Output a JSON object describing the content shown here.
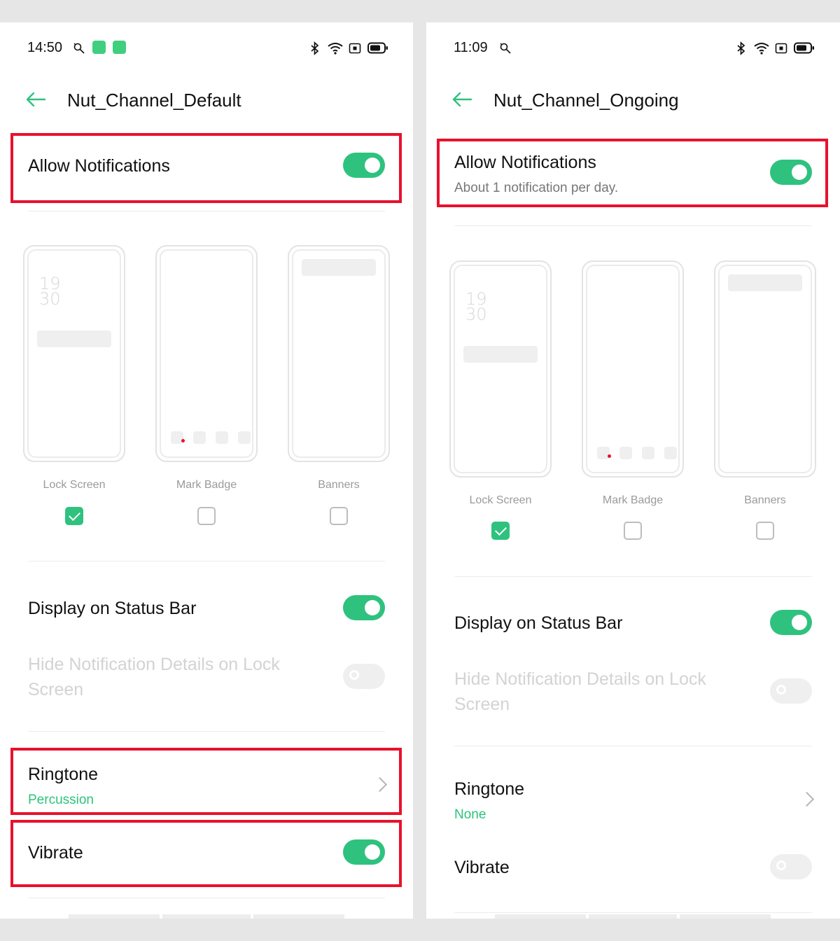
{
  "colors": {
    "accent": "#2ec27e",
    "highlight": "#e8112d",
    "disabled_text": "#d3d3d3"
  },
  "left": {
    "time": "14:50",
    "status_icons": [
      "bluetooth-icon",
      "wifi-icon",
      "nfc-icon",
      "battery-icon"
    ],
    "title": "Nut_Channel_Default",
    "allow_notifications": {
      "label": "Allow Notifications",
      "on": true
    },
    "options": [
      {
        "label": "Lock Screen",
        "checked": true
      },
      {
        "label": "Mark Badge",
        "checked": false
      },
      {
        "label": "Banners",
        "checked": false
      }
    ],
    "display_status_bar": {
      "label": "Display on Status Bar",
      "on": true
    },
    "hide_details": {
      "label": "Hide Notification Details on Lock Screen",
      "on": false,
      "enabled": false
    },
    "ringtone": {
      "label": "Ringtone",
      "value": "Percussion"
    },
    "vibrate": {
      "label": "Vibrate",
      "on": true
    }
  },
  "right": {
    "time": "11:09",
    "status_icons": [
      "bluetooth-icon",
      "wifi-icon",
      "nfc-icon",
      "battery-icon"
    ],
    "title": "Nut_Channel_Ongoing",
    "allow_notifications": {
      "label": "Allow Notifications",
      "subtitle": "About 1 notification per day.",
      "on": true
    },
    "options": [
      {
        "label": "Lock Screen",
        "checked": true
      },
      {
        "label": "Mark Badge",
        "checked": false
      },
      {
        "label": "Banners",
        "checked": false
      }
    ],
    "display_status_bar": {
      "label": "Display on Status Bar",
      "on": true
    },
    "hide_details": {
      "label": "Hide Notification Details on Lock Screen",
      "on": false,
      "enabled": false
    },
    "ringtone": {
      "label": "Ringtone",
      "value": "None"
    },
    "vibrate": {
      "label": "Vibrate",
      "on": false
    }
  },
  "preview_clock": {
    "hour": "19",
    "minute": "30"
  }
}
